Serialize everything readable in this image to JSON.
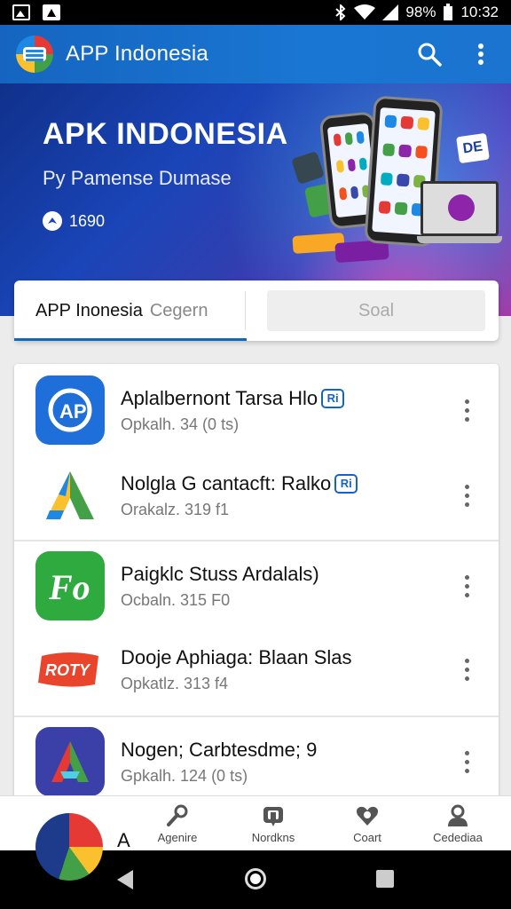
{
  "status_bar": {
    "battery_text": "98%",
    "time": "10:32",
    "icons": [
      "image-icon",
      "triangle-app-icon",
      "bluetooth-icon",
      "wifi-icon",
      "signal-icon",
      "battery-icon"
    ]
  },
  "app_bar": {
    "title": "APP Indonesia",
    "logo": "app-logo",
    "actions": [
      "search-icon",
      "more-vert-icon"
    ]
  },
  "hero": {
    "title": "APK INDONESIA",
    "subtitle": "Py Pamense Dumase",
    "count": "1690",
    "badge": "DE"
  },
  "tabs": {
    "active_label": "APP Inonesia",
    "active_secondary": "Cegern",
    "field_placeholder": "Soal"
  },
  "apps": [
    {
      "name": "Aplalbernont Tarsa Hlo",
      "meta": "Opkalh. 34 (0 ts)",
      "badge": "Ri",
      "icon_color": "#1e6fd9",
      "icon": "ap-logo-icon"
    },
    {
      "name": "Nolgla G cantacft: Ralko",
      "meta": "Orakalz. 319 f1",
      "badge": "Ri",
      "icon_color": "#ffffff",
      "icon": "a-triangle-logo-icon"
    },
    {
      "name": "Paigklc Stuss  Ardalals)",
      "meta": "Ocbaln. 315 F0",
      "badge": "",
      "icon_color": "#2eaa3f",
      "icon": "fp-logo-icon"
    },
    {
      "name": "Dooje Aphiaga: Blaan Slas",
      "meta": "Opkatlz. 313 f4",
      "badge": "",
      "icon_color": "#ffffff",
      "icon": "rofy-logo-icon"
    },
    {
      "name": "Nogen; Carbtesdme; 9",
      "meta": "Gpkalh. 124 (0 ts)",
      "badge": "",
      "icon_color": "#3b3fa8",
      "icon": "a-colorful-logo-icon"
    }
  ],
  "bottom_nav": {
    "peek_letter": "A",
    "items": [
      {
        "label": "Agenire",
        "icon": "wrench-icon"
      },
      {
        "label": "Nordkns",
        "icon": "gamepad-icon"
      },
      {
        "label": "Coart",
        "icon": "heart-shield-icon"
      },
      {
        "label": "Cedediaa",
        "icon": "person-icon"
      }
    ]
  },
  "colors": {
    "primary": "#1565c0",
    "hero_start": "#10308a",
    "hero_end": "#b02a9a",
    "background": "#ececec"
  }
}
